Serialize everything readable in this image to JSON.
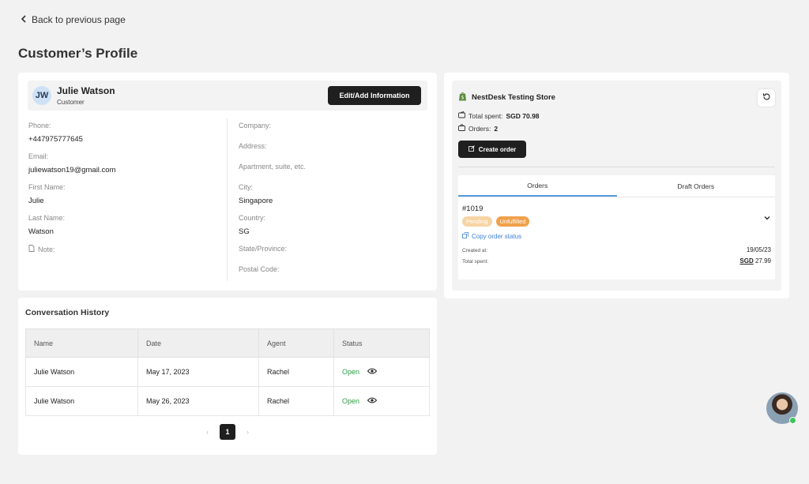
{
  "nav": {
    "back_label": "Back to previous page"
  },
  "page": {
    "title": "Customer’s Profile"
  },
  "customer": {
    "initials": "JW",
    "name": "Julie Watson",
    "role": "Customer",
    "edit_label": "Edit/Add Information",
    "fields_left": [
      {
        "label": "Phone:",
        "value": "+447975777645"
      },
      {
        "label": "Email:",
        "value": "juliewatson19@gmail.com"
      },
      {
        "label": "First Name:",
        "value": "Julie"
      },
      {
        "label": "Last Name:",
        "value": "Watson"
      },
      {
        "label": "Note:",
        "value": ""
      }
    ],
    "fields_right": [
      {
        "label": "Company:",
        "value": ""
      },
      {
        "label": "Address:",
        "value": ""
      },
      {
        "label": "Apartment, suite, etc.",
        "value": ""
      },
      {
        "label": "City:",
        "value": "Singapore"
      },
      {
        "label": "Country:",
        "value": "SG"
      },
      {
        "label": "State/Province:",
        "value": ""
      },
      {
        "label": "Postal Code:",
        "value": ""
      }
    ]
  },
  "conversation": {
    "title": "Conversation History",
    "columns": [
      "Name",
      "Date",
      "Agent",
      "Status"
    ],
    "rows": [
      {
        "name": "Julie Watson",
        "date": "May 17, 2023",
        "agent": "Rachel",
        "status": "Open"
      },
      {
        "name": "Julie Watson",
        "date": "May 26, 2023",
        "agent": "Rachel",
        "status": "Open"
      }
    ],
    "pagination": {
      "prev": "‹",
      "current": "1",
      "next": "›"
    }
  },
  "store": {
    "name": "NestDesk Testing Store",
    "total_spent_label": "Total spent:",
    "total_spent_value": "SGD 70.98",
    "orders_label": "Orders:",
    "orders_value": "2",
    "create_order_label": "Create order",
    "tabs": [
      "Orders",
      "Draft Orders"
    ],
    "active_tab": "Orders",
    "order": {
      "id": "#1019",
      "badges": [
        "Pending",
        "Unfulfilled"
      ],
      "copy_label": "Copy order status",
      "created_label": "Created at:",
      "created_value": "19/05/23",
      "spent_label": "Total spent:",
      "spent_currency": "SGD",
      "spent_amount": "27.99"
    }
  },
  "colors": {
    "accent": "#1f1f1f",
    "open_status": "#2e9e44",
    "pending_badge": "#f7d4a4",
    "unfulfilled_badge": "#f0a04b",
    "link": "#3b82d6",
    "online": "#3cc35a"
  },
  "icons": [
    "chevron-left-icon",
    "note-icon",
    "eye-icon",
    "shopify-icon",
    "refresh-icon",
    "wallet-icon",
    "bag-icon",
    "edit-icon",
    "copy-icon",
    "chevron-down-icon"
  ]
}
